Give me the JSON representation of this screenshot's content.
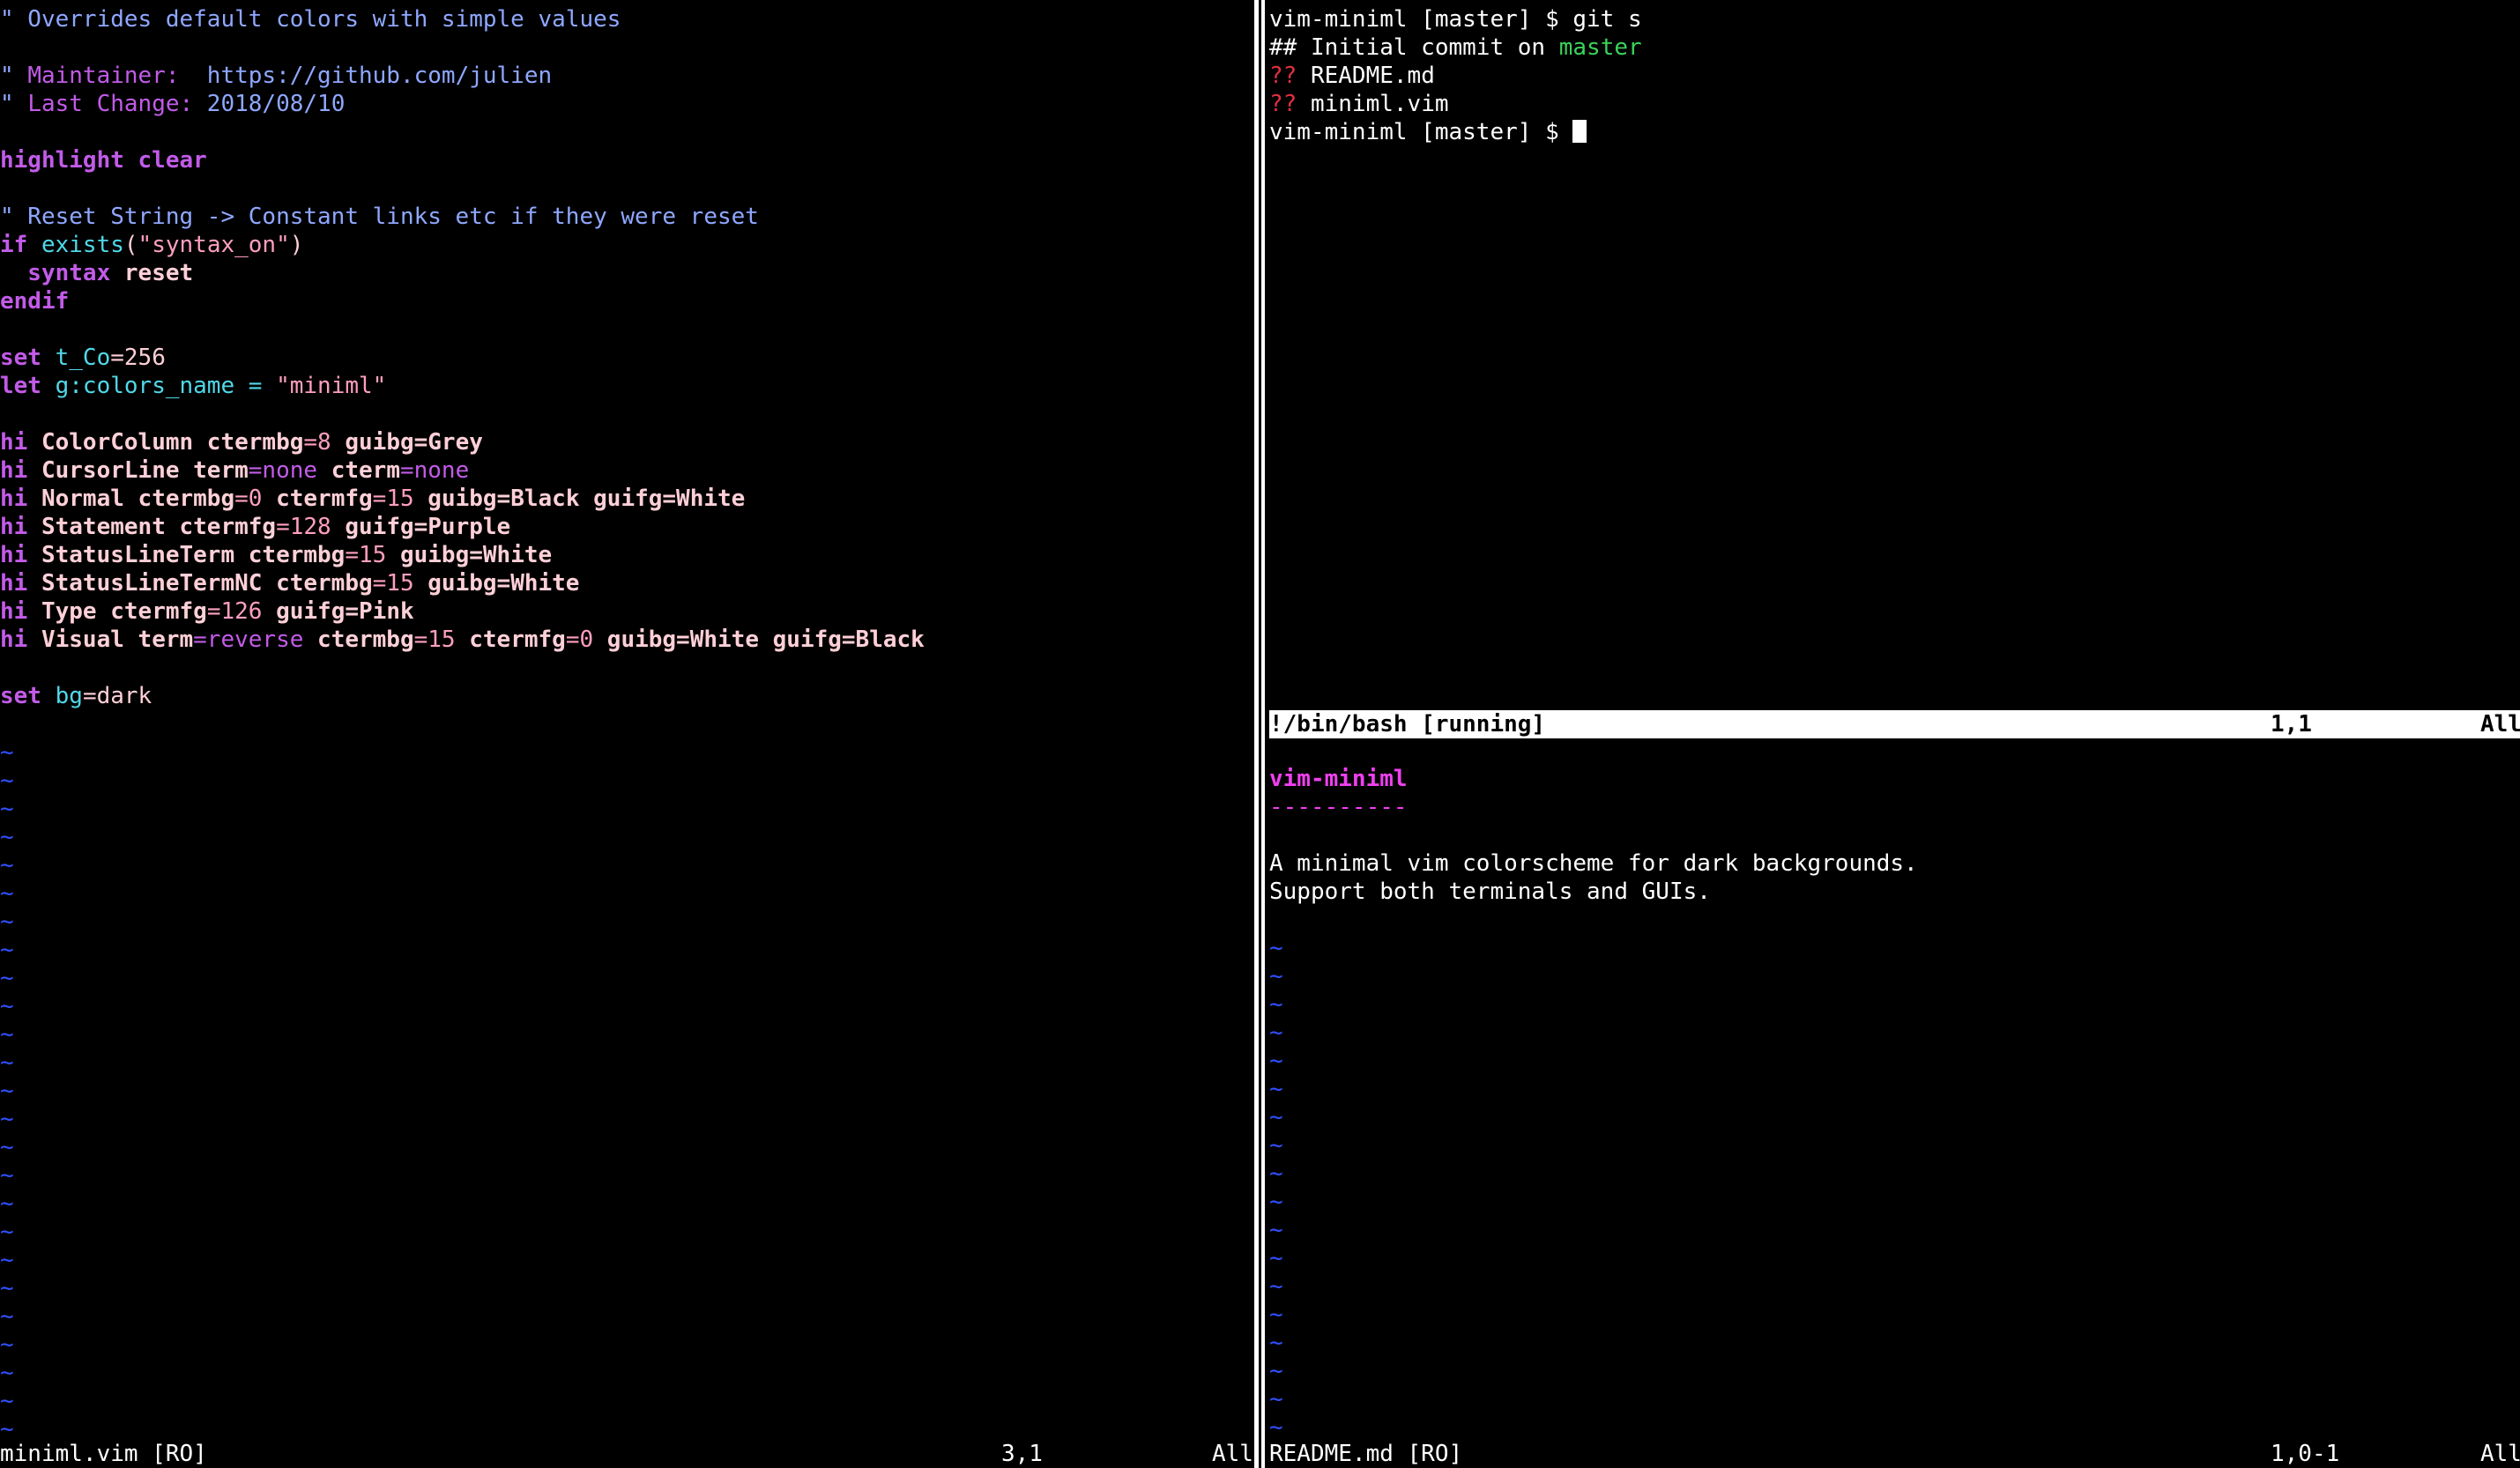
{
  "colors": {
    "background": "#000000",
    "comment": "#8fa7ff",
    "keyword": "#c25be8",
    "identifier": "#50d8e8",
    "string": "#ff9fc0",
    "number": "#ff9fc0",
    "hi_group": "#ffd0d8",
    "tilde": "#3050ff",
    "git_branch": "#3ad35a",
    "git_untracked": "#e0303f",
    "readme_title": "#f040f0",
    "status_bg": "#ffffff"
  },
  "left_pane": {
    "lines": [
      [
        {
          "t": "\" Overrides default colors with simple values",
          "c": "comment"
        }
      ],
      [],
      [
        {
          "t": "\" ",
          "c": "comment"
        },
        {
          "t": "Maintainer:",
          "c": "keyword"
        },
        {
          "t": "  https://github.com/julien",
          "c": "comment"
        }
      ],
      [
        {
          "t": "\" ",
          "c": "comment"
        },
        {
          "t": "Last Change:",
          "c": "keyword"
        },
        {
          "t": " 2018/08/10",
          "c": "comment"
        }
      ],
      [],
      [
        {
          "t": "highlight clear",
          "c": "keyword",
          "b": true
        }
      ],
      [],
      [
        {
          "t": "\" Reset String -> Constant links etc if they were reset",
          "c": "comment"
        }
      ],
      [
        {
          "t": "if",
          "c": "keyword",
          "b": true
        },
        {
          "t": " exists",
          "c": "identifier"
        },
        {
          "t": "(",
          "c": "hi_group"
        },
        {
          "t": "\"syntax_on\"",
          "c": "string"
        },
        {
          "t": ")",
          "c": "hi_group"
        }
      ],
      [
        {
          "t": "  syntax",
          "c": "keyword",
          "b": true
        },
        {
          "t": " reset",
          "c": "hi_group",
          "b": true
        }
      ],
      [
        {
          "t": "endif",
          "c": "keyword",
          "b": true
        }
      ],
      [],
      [
        {
          "t": "set",
          "c": "keyword",
          "b": true
        },
        {
          "t": " t_Co",
          "c": "identifier"
        },
        {
          "t": "=256",
          "c": "hi_group"
        }
      ],
      [
        {
          "t": "let",
          "c": "keyword",
          "b": true
        },
        {
          "t": " g:colors_name",
          "c": "identifier"
        },
        {
          "t": " = ",
          "c": "identifier"
        },
        {
          "t": "\"miniml\"",
          "c": "string"
        }
      ],
      [],
      [
        {
          "t": "hi",
          "c": "keyword",
          "b": true
        },
        {
          "t": " ColorColumn ctermbg",
          "c": "hi_group",
          "b": true
        },
        {
          "t": "=8",
          "c": "number"
        },
        {
          "t": " guibg=Grey",
          "c": "hi_group",
          "b": true
        }
      ],
      [
        {
          "t": "hi",
          "c": "keyword",
          "b": true
        },
        {
          "t": " CursorLine term",
          "c": "hi_group",
          "b": true
        },
        {
          "t": "=none",
          "c": "keyword"
        },
        {
          "t": " cterm",
          "c": "hi_group",
          "b": true
        },
        {
          "t": "=none",
          "c": "keyword"
        }
      ],
      [
        {
          "t": "hi",
          "c": "keyword",
          "b": true
        },
        {
          "t": " Normal ctermbg",
          "c": "hi_group",
          "b": true
        },
        {
          "t": "=0",
          "c": "number"
        },
        {
          "t": " ctermfg",
          "c": "hi_group",
          "b": true
        },
        {
          "t": "=15",
          "c": "number"
        },
        {
          "t": " guibg=Black guifg=White",
          "c": "hi_group",
          "b": true
        }
      ],
      [
        {
          "t": "hi",
          "c": "keyword",
          "b": true
        },
        {
          "t": " Statement ctermfg",
          "c": "hi_group",
          "b": true
        },
        {
          "t": "=128",
          "c": "number"
        },
        {
          "t": " guifg=Purple",
          "c": "hi_group",
          "b": true
        }
      ],
      [
        {
          "t": "hi",
          "c": "keyword",
          "b": true
        },
        {
          "t": " StatusLineTerm ctermbg",
          "c": "hi_group",
          "b": true
        },
        {
          "t": "=15",
          "c": "number"
        },
        {
          "t": " guibg=White",
          "c": "hi_group",
          "b": true
        }
      ],
      [
        {
          "t": "hi",
          "c": "keyword",
          "b": true
        },
        {
          "t": " StatusLineTermNC ctermbg",
          "c": "hi_group",
          "b": true
        },
        {
          "t": "=15",
          "c": "number"
        },
        {
          "t": " guibg=White",
          "c": "hi_group",
          "b": true
        }
      ],
      [
        {
          "t": "hi",
          "c": "keyword",
          "b": true
        },
        {
          "t": " Type ctermfg",
          "c": "hi_group",
          "b": true
        },
        {
          "t": "=126",
          "c": "number"
        },
        {
          "t": " guifg=Pink",
          "c": "hi_group",
          "b": true
        }
      ],
      [
        {
          "t": "hi",
          "c": "keyword",
          "b": true
        },
        {
          "t": " Visual term",
          "c": "hi_group",
          "b": true
        },
        {
          "t": "=reverse",
          "c": "keyword"
        },
        {
          "t": " ctermbg",
          "c": "hi_group",
          "b": true
        },
        {
          "t": "=15",
          "c": "number"
        },
        {
          "t": " ctermfg",
          "c": "hi_group",
          "b": true
        },
        {
          "t": "=0",
          "c": "number"
        },
        {
          "t": " guibg=White guifg=Black",
          "c": "hi_group",
          "b": true
        }
      ],
      [],
      [
        {
          "t": "set",
          "c": "keyword",
          "b": true
        },
        {
          "t": " bg",
          "c": "identifier"
        },
        {
          "t": "=dark",
          "c": "hi_group"
        }
      ]
    ],
    "tilde": "~",
    "tilde_count": 25,
    "status": {
      "file": "miniml.vim [RO]",
      "pos": "3,1",
      "scroll": "All"
    }
  },
  "terminal": {
    "lines": [
      [
        {
          "t": "vim-miniml [master] $ git s",
          "c": "plain"
        }
      ],
      [
        {
          "t": "## Initial commit on ",
          "c": "plain"
        },
        {
          "t": "master",
          "c": "git_branch"
        }
      ],
      [
        {
          "t": "??",
          "c": "git_untracked"
        },
        {
          "t": " README.md",
          "c": "plain"
        }
      ],
      [
        {
          "t": "??",
          "c": "git_untracked"
        },
        {
          "t": " miniml.vim",
          "c": "plain"
        }
      ],
      [
        {
          "t": "vim-miniml [master] $ ",
          "c": "plain"
        }
      ]
    ],
    "status": {
      "name": "!/bin/bash [running]",
      "pos": "1,1",
      "scroll": "All"
    }
  },
  "readme": {
    "lines": [
      [
        {
          "t": "vim-miniml",
          "c": "readme_title",
          "b": true
        }
      ],
      [
        {
          "t": "----------",
          "c": "readme_title"
        }
      ],
      [],
      [
        {
          "t": "A minimal vim colorscheme for dark backgrounds.",
          "c": "plain"
        }
      ],
      [
        {
          "t": "Support both terminals and GUIs.",
          "c": "plain"
        }
      ]
    ],
    "tilde": "~",
    "tilde_count": 18,
    "status": {
      "file": "README.md [RO]",
      "pos": "1,0-1",
      "scroll": "All"
    }
  }
}
